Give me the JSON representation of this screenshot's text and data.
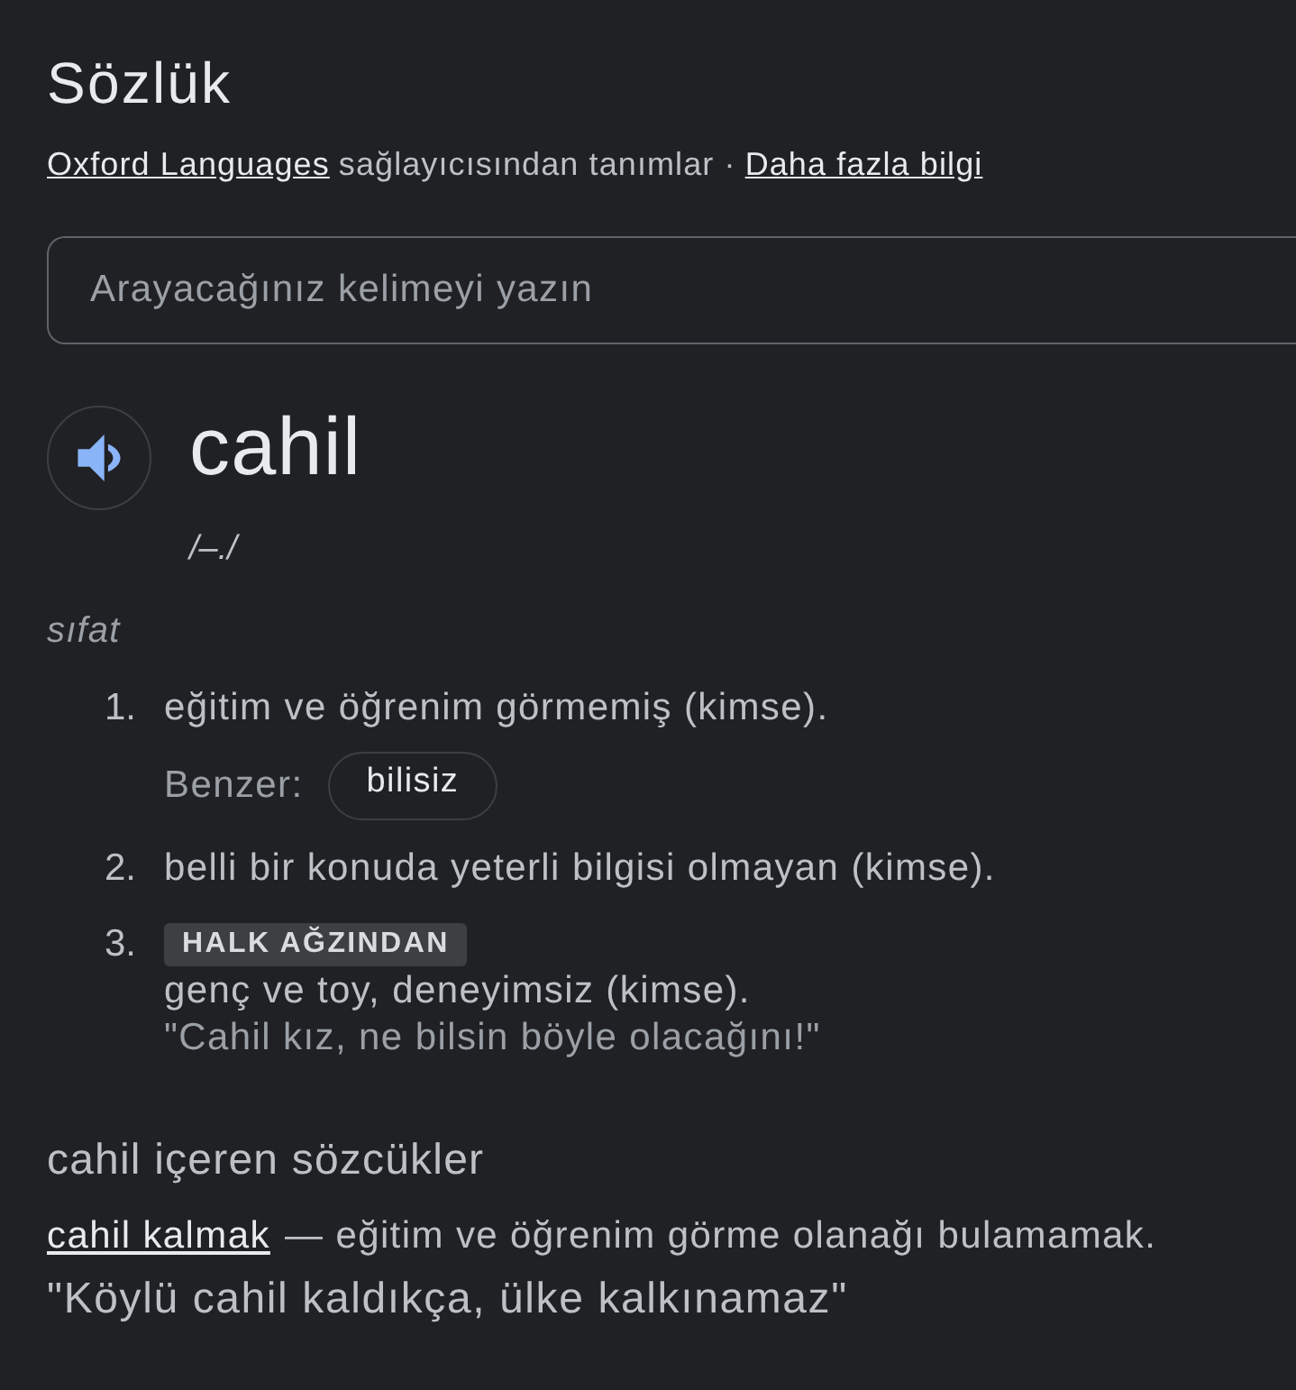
{
  "header": {
    "title": "Sözlük",
    "source_link": "Oxford Languages",
    "source_text": "sağlayıcısından tanımlar ·",
    "more_link": "Daha fazla bilgi"
  },
  "search": {
    "placeholder": "Arayacağınız kelimeyi yazın"
  },
  "entry": {
    "word": "cahil",
    "phonetic": "/–./",
    "part_of_speech": "sıfat",
    "senses": [
      {
        "number": "1.",
        "definition": "eğitim ve öğrenim görmemiş (kimse).",
        "similar_label": "Benzer:",
        "similar": [
          "bilisiz"
        ]
      },
      {
        "number": "2.",
        "definition": "belli bir konuda yeterli bilgisi olmayan (kimse)."
      },
      {
        "number": "3.",
        "label": "HALK AĞZINDAN",
        "definition": "genç ve toy, deneyimsiz (kimse).",
        "example": "\"Cahil kız, ne bilsin böyle olacağını!\""
      }
    ]
  },
  "related": {
    "title": "cahil içeren sözcükler",
    "items": [
      {
        "term": "cahil kalmak",
        "definition": "— eğitim ve öğrenim görme olanağı bulamamak.",
        "example": "\"Köylü cahil kaldıkça, ülke kalkınamaz\""
      }
    ]
  }
}
